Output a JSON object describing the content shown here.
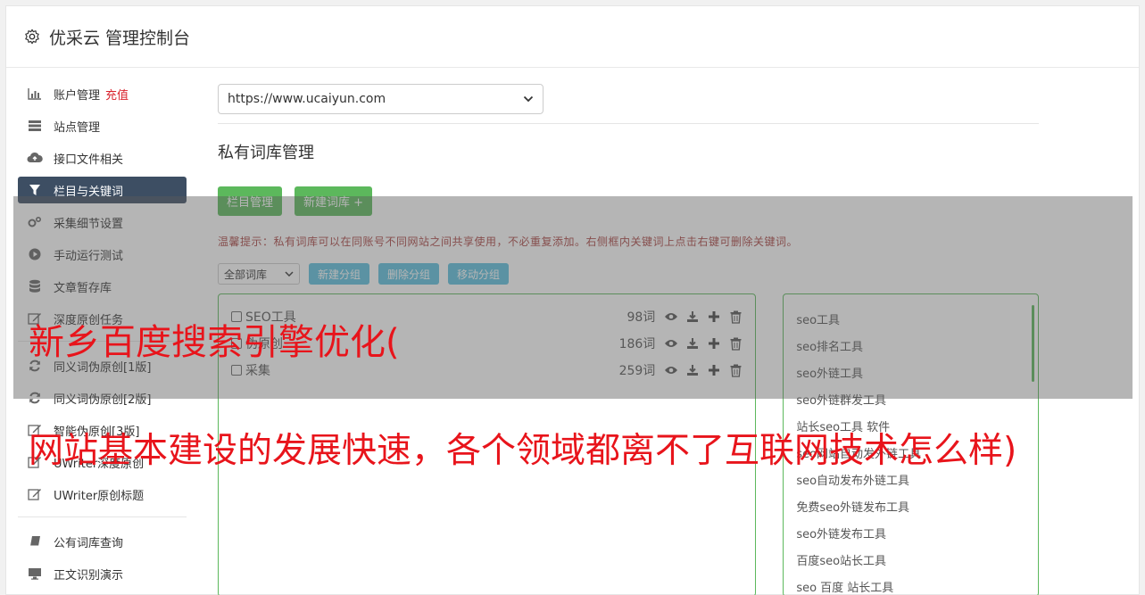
{
  "header": {
    "title": "优采云 管理控制台"
  },
  "sidebar": {
    "items": [
      {
        "label": "账户管理",
        "accent": "充值",
        "icon": "bar-chart-icon"
      },
      {
        "label": "站点管理",
        "icon": "server-icon"
      },
      {
        "label": "接口文件相关",
        "icon": "cloud-upload-icon"
      },
      {
        "label": "栏目与关键词",
        "icon": "filter-icon",
        "active": true
      },
      {
        "label": "采集细节设置",
        "icon": "cogs-icon"
      },
      {
        "label": "手动运行测试",
        "icon": "play-circle-icon"
      },
      {
        "label": "文章暂存库",
        "icon": "database-icon"
      },
      {
        "label": "深度原创任务",
        "icon": "edit-icon"
      }
    ],
    "items2": [
      {
        "label": "同义词伪原创[1版]",
        "icon": "refresh-icon"
      },
      {
        "label": "同义词伪原创[2版]",
        "icon": "refresh-icon"
      },
      {
        "label": "智能伪原创[3版]",
        "icon": "edit-icon"
      },
      {
        "label": "UWriter深度原创",
        "icon": "edit-icon"
      },
      {
        "label": "UWriter原创标题",
        "icon": "edit-icon"
      }
    ],
    "items3": [
      {
        "label": "公有词库查询",
        "icon": "book-icon"
      },
      {
        "label": "正文识别演示",
        "icon": "monitor-icon"
      }
    ]
  },
  "main": {
    "site_select": "https://www.ucaiyun.com",
    "section_title": "私有词库管理",
    "btn_column": "栏目管理",
    "btn_new_lib": "新建词库 +",
    "tip": "温馨提示：私有词库可以在同账号不同网站之间共享使用，不必重复添加。右侧框内关键词上点击右键可删除关键词。",
    "filter_select": "全部词库",
    "btn_new_group": "新建分组",
    "btn_del_group": "删除分组",
    "btn_move_group": "移动分组",
    "libraries": [
      {
        "name": "SEO工具",
        "count": "98词"
      },
      {
        "name": "伪原创",
        "count": "186词"
      },
      {
        "name": "采集",
        "count": "259词"
      }
    ],
    "keywords": [
      "seo工具",
      "seo排名工具",
      "seo外链工具",
      "seo外链群发工具",
      "站长seo工具 软件",
      "seo网站自动发外链工具",
      "seo自动发布外链工具",
      "免费seo外链发布工具",
      "seo外链发布工具",
      "百度seo站长工具",
      "seo 百度 站长工具"
    ]
  },
  "overlay": {
    "line1": "新乡百度搜索引擎优化(",
    "line2": "网站基本建设的发展快速，各个领域都离不了互联网技术怎么样)"
  },
  "colors": {
    "green": "#5cb85c",
    "blue": "#5bc0de",
    "active_nav": "#3d4e63",
    "accent_red": "#d9232d",
    "overlay_text": "#e8141b"
  }
}
